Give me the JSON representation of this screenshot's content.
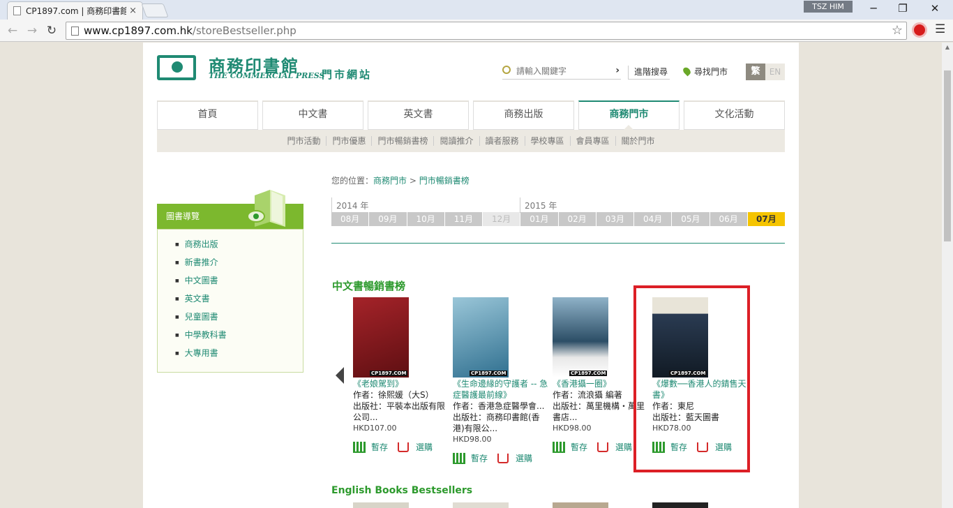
{
  "browser": {
    "tab_title": "CP1897.com | 商務印書館",
    "tab_close": "×",
    "profile_name": "TSZ HIM",
    "url_host": "www.cp1897.com.hk",
    "url_path": "/storeBestseller.php"
  },
  "header": {
    "logo_cn": "商務印書館",
    "logo_en": "THE COMMERCIAL PRESS",
    "site_label": "門市網站",
    "search_placeholder": "請輸入關鍵字",
    "advanced_search": "進階搜尋",
    "store_finder": "尋找門市",
    "lang_tc": "繁",
    "lang_en": "EN"
  },
  "main_nav": [
    {
      "label": "首頁"
    },
    {
      "label": "中文書"
    },
    {
      "label": "英文書"
    },
    {
      "label": "商務出版"
    },
    {
      "label": "商務門市",
      "active": true
    },
    {
      "label": "文化活動"
    }
  ],
  "sub_nav": [
    "門市活動",
    "門市優惠",
    "門市暢銷書榜",
    "閱讀推介",
    "讀者服務",
    "學校專區",
    "會員專區",
    "關於門市"
  ],
  "sidebar": {
    "title": "圖書導覽",
    "items": [
      "商務出版",
      "新書推介",
      "中文圖書",
      "英文書",
      "兒童圖書",
      "中學教科書",
      "大專用書"
    ]
  },
  "breadcrumb": {
    "prefix": "您的位置：",
    "level1": "商務門市",
    "separator": ">",
    "level2": "門市暢銷書榜"
  },
  "timeline": {
    "year_2014": "2014 年",
    "year_2015": "2015 年",
    "months": [
      {
        "label": "08月"
      },
      {
        "label": "09月"
      },
      {
        "label": "10月"
      },
      {
        "label": "11月"
      },
      {
        "label": "12月",
        "state": "disabled"
      },
      {
        "label": "01月"
      },
      {
        "label": "02月"
      },
      {
        "label": "03月"
      },
      {
        "label": "04月"
      },
      {
        "label": "05月"
      },
      {
        "label": "06月"
      },
      {
        "label": "07月",
        "state": "active"
      }
    ]
  },
  "chinese_section": {
    "title": "中文書暢銷書榜",
    "brand_mark": "CP1897.COM",
    "books": [
      {
        "title": "《老娘駕到》",
        "author": "作者：徐熙媛（大S）",
        "publisher": "出版社：平裝本出版有限公司...",
        "price": "HKD107.00",
        "save": "暫存",
        "buy": "選購",
        "cover_color": "#8b1a1e"
      },
      {
        "title": "《生命邊緣的守護者 -- 急症醫護最前線》",
        "author": "作者：香港急症醫學會...",
        "publisher": "出版社：商務印書館(香港)有限公...",
        "price": "HKD98.00",
        "save": "暫存",
        "buy": "選購",
        "cover_color": "#3c7e9e"
      },
      {
        "title": "《香港攝一圈》",
        "author": "作者：流浪攝 編著",
        "publisher": "出版社：萬里機構・萬里書店...",
        "price": "HKD98.00",
        "save": "暫存",
        "buy": "選購",
        "cover_color": "#33556e"
      },
      {
        "title": "《爆數──香港人的錆售天書》",
        "author": "作者：東尼",
        "publisher": "出版社：藍天圖書",
        "price": "HKD78.00",
        "save": "暫存",
        "buy": "選購",
        "cover_color": "#1d2b3a"
      }
    ]
  },
  "english_section": {
    "title": "English Books Bestsellers"
  }
}
